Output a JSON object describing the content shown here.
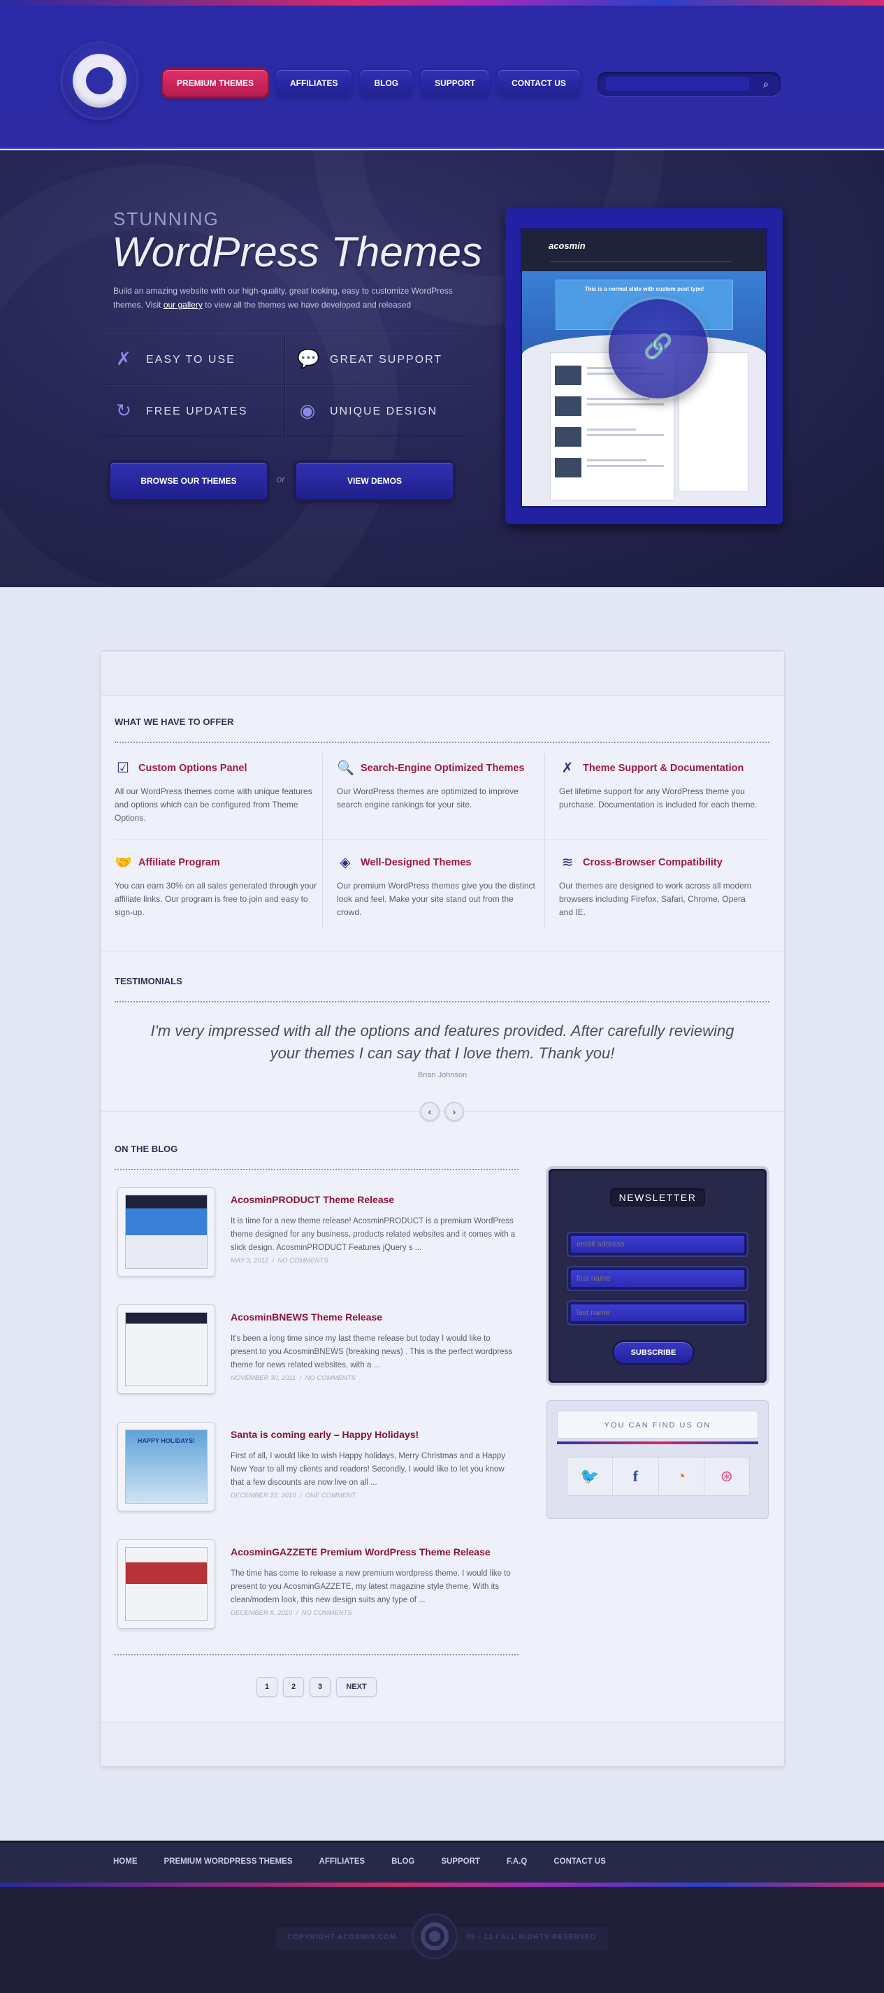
{
  "nav": {
    "items": [
      "Premium Themes",
      "Affiliates",
      "Blog",
      "Support",
      "Contact Us"
    ],
    "active_index": 0
  },
  "search": {
    "placeholder": "",
    "icon": "search-icon"
  },
  "hero": {
    "eyebrow": "STUNNING",
    "title": "WordPress Themes",
    "desc_before": "Build an amazing website with our high-quality, great looking, easy to customize WordPress themes. Visit ",
    "desc_link": "our gallery",
    "desc_after": " to view all the themes we have developed and released",
    "features": [
      {
        "label": "EASY TO USE",
        "icon": "wrench-icon"
      },
      {
        "label": "GREAT SUPPORT",
        "icon": "chat-icon"
      },
      {
        "label": "FREE UPDATES",
        "icon": "refresh-icon"
      },
      {
        "label": "UNIQUE DESIGN",
        "icon": "eye-icon"
      }
    ],
    "browse_label": "BROWSE OUR THEMES",
    "or_label": "or",
    "demos_label": "VIEW DEMOS",
    "preview": {
      "brand": "acosmin",
      "slide_title": "This is a normal slide with custom post type!",
      "link_icon": "link-icon"
    }
  },
  "offer": {
    "heading": "WHAT WE HAVE TO OFFER",
    "items": [
      {
        "icon": "checkbox-icon",
        "title": "Custom Options Panel",
        "text": "All our WordPress themes come with unique features and options which can be configured from Theme Options."
      },
      {
        "icon": "magnifier-icon",
        "title": "Search-Engine Optimized Themes",
        "text": "Our WordPress themes are optimized to improve search engine rankings for your site."
      },
      {
        "icon": "tools-icon",
        "title": "Theme Support & Documentation",
        "text": "Get lifetime support for any WordPress theme you purchase. Documentation is included for each theme."
      },
      {
        "icon": "handshake-icon",
        "title": "Affiliate Program",
        "text": "You can earn 30% on all sales generated through your affiliate links. Our program is free to join and easy to sign-up."
      },
      {
        "icon": "paint-bucket-icon",
        "title": "Well-Designed Themes",
        "text": "Our premium WordPress themes give you the distinct look and feel. Make your site stand out from the crowd."
      },
      {
        "icon": "layers-icon",
        "title": "Cross-Browser Compatibility",
        "text": "Our themes are designed to work across all modern browsers including Firefox, Safari, Chrome, Opera and IE."
      }
    ]
  },
  "testimonials": {
    "heading": "TESTIMONIALS",
    "quote": "I'm very impressed with all the options and features provided. After carefully reviewing your themes I can say that I love them. Thank you!",
    "author": "Brian Johnson"
  },
  "blog": {
    "heading": "ON THE BLOG",
    "posts": [
      {
        "title": "AcosminPRODUCT Theme Release",
        "excerpt": "It is time for a new theme release! AcosminPRODUCT is a premium WordPress theme designed for any business, products related websites and it comes with a slick design. AcosminPRODUCT Features jQuery s ...",
        "date": "MAY 3, 2012",
        "comments": "NO COMMENTS"
      },
      {
        "title": "AcosminBNEWS Theme Release",
        "excerpt": "It's been a long time since my last theme release but today I would like to present to you AcosminBNEWS (breaking news) . This is the perfect wordpress theme for news related websites, with a ...",
        "date": "NOVEMBER 30, 2011",
        "comments": "NO COMMENTS"
      },
      {
        "title": "Santa is coming early – Happy Holidays!",
        "excerpt": "First of all, I would like to wish Happy holidays, Merry Christmas and a Happy New Year to all my clients and readers! Secondly, I would like to let you know that a few discounts are now live on all ...",
        "date": "DECEMBER 22, 2010",
        "comments": "ONE COMMENT",
        "thumb_text": "HAPPY HOLIDAYS!"
      },
      {
        "title": "AcosminGAZZETE Premium WordPress Theme Release",
        "excerpt": "The time has come to release a new premium wordpress theme. I would like to present to you AcosminGAZZETE, my latest magazine style theme. With its clean/modern look, this new design suits any type of ...",
        "date": "DECEMBER 8, 2010",
        "comments": "NO COMMENTS"
      }
    ],
    "separator": "/",
    "pages": [
      "1",
      "2",
      "3"
    ],
    "next_label": "NEXT"
  },
  "newsletter": {
    "title": "NEWSLETTER",
    "fields": [
      "email address",
      "first name",
      "last name"
    ],
    "subscribe_label": "SUBSCRIBE"
  },
  "social": {
    "title": "YOU CAN FIND US ON",
    "icons": [
      "twitter-icon",
      "facebook-icon",
      "rss-icon",
      "dribbble-icon"
    ]
  },
  "footer": {
    "nav": [
      "HOME",
      "PREMIUM WORDPRESS THEMES",
      "AFFILIATES",
      "BLOG",
      "SUPPORT",
      "F.A.Q",
      "CONTACT US"
    ],
    "copyright": "COPYRIGHT ACOSMIN.COM",
    "rights": "09 - 12 / ALL RIGHTS RESERVED"
  },
  "colors": {
    "brand_blue": "#2a2aa8",
    "accent_red": "#d0265e",
    "title_red": "#9c1c40",
    "dark": "#1f2038"
  }
}
